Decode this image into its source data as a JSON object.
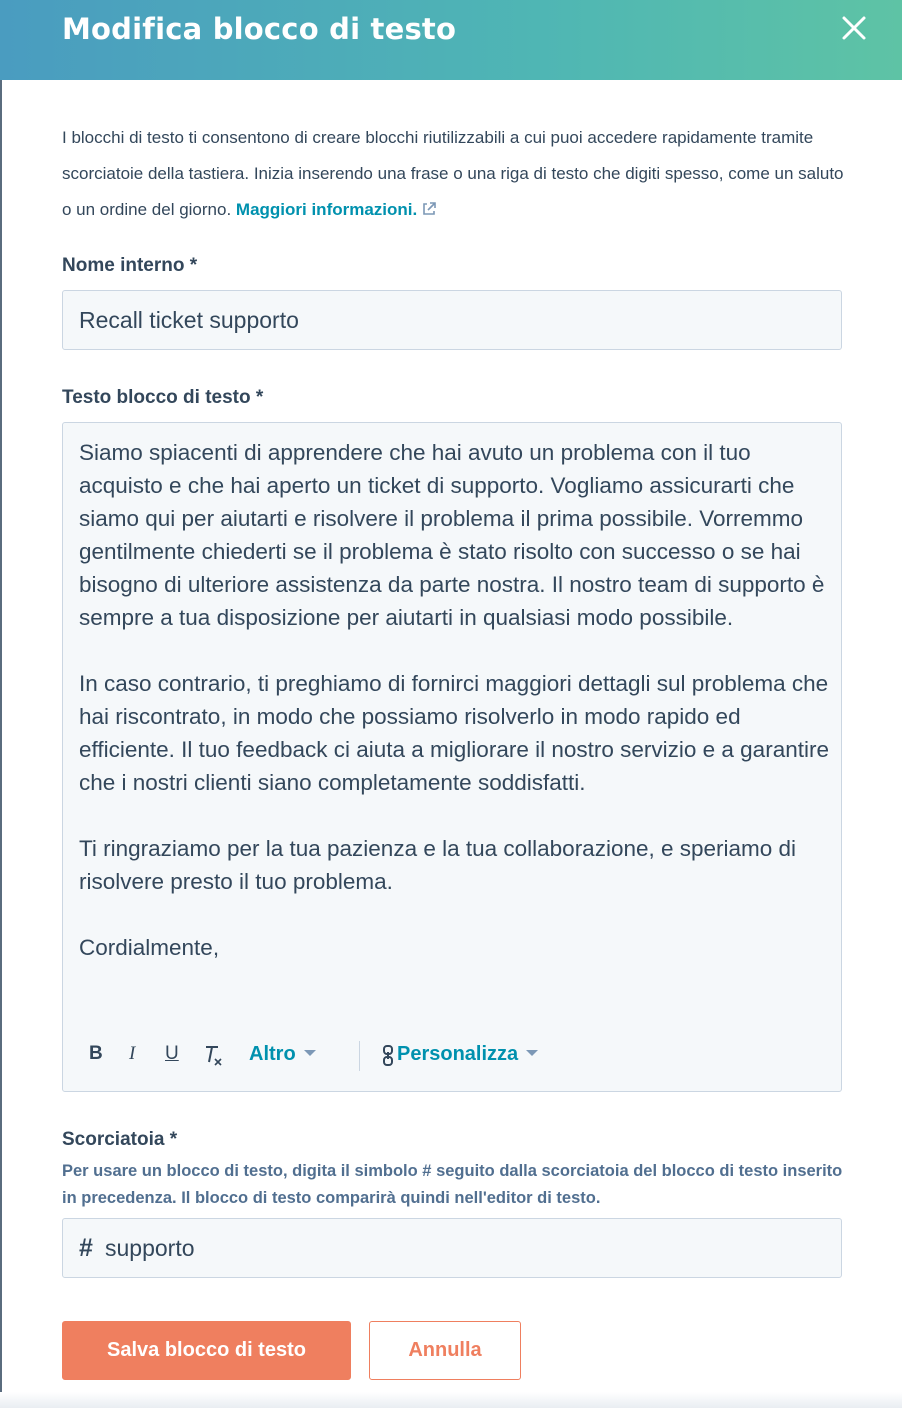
{
  "header": {
    "title": "Modifica blocco di testo",
    "close_icon": "close-icon",
    "gradient_start": "#4a9cc0",
    "gradient_end": "#5ec3a5"
  },
  "intro": {
    "text": "I blocchi di testo ti consentono di creare blocchi riutilizzabili a cui puoi accedere rapidamente tramite scorciatoie della tastiera. Inizia inserendo una frase o una riga di testo che digiti spesso, come un saluto o un ordine del giorno. ",
    "link_label": "Maggiori informazioni.",
    "link_icon": "external-link-icon"
  },
  "internal_name": {
    "label": "Nome interno *",
    "value": "Recall ticket supporto"
  },
  "block_text": {
    "label": "Testo blocco di testo *",
    "value": "Siamo spiacenti di apprendere che hai avuto un problema con il tuo acquisto e che hai aperto un ticket di supporto. Vogliamo assicurarti che siamo qui per aiutarti e risolvere il problema il prima possibile. Vorremmo gentilmente chiederti se il problema è stato risolto con successo o se hai bisogno di ulteriore assistenza da parte nostra. Il nostro team di supporto è sempre a tua disposizione per aiutarti in qualsiasi modo possibile.\n\nIn caso contrario, ti preghiamo di fornirci maggiori dettagli sul problema che hai riscontrato, in modo che possiamo risolverlo in modo rapido ed efficiente. Il tuo feedback ci aiuta a migliorare il nostro servizio e a garantire che i nostri clienti siano completamente soddisfatti.\n\nTi ringraziamo per la tua pazienza e la tua collaborazione, e speriamo di risolvere presto il tuo problema.\n\nCordialmente,"
  },
  "toolbar": {
    "bold_label": "B",
    "italic_label": "I",
    "underline_label": "U",
    "clear_format_icon": "clear-format-icon",
    "more_label": "Altro",
    "personalize_icon": "personalize-icon",
    "personalize_label": "Personalizza"
  },
  "shortcut": {
    "label": "Scorciatoia *",
    "help": "Per usare un blocco di testo, digita il simbolo # seguito dalla scorciatoia del blocco di testo inserito in precedenza. Il blocco di testo comparirà quindi nell'editor di testo.",
    "prefix": "#",
    "value": "supporto"
  },
  "actions": {
    "save_label": "Salva blocco di testo",
    "cancel_label": "Annulla",
    "accent_color": "#ef7f5f"
  }
}
